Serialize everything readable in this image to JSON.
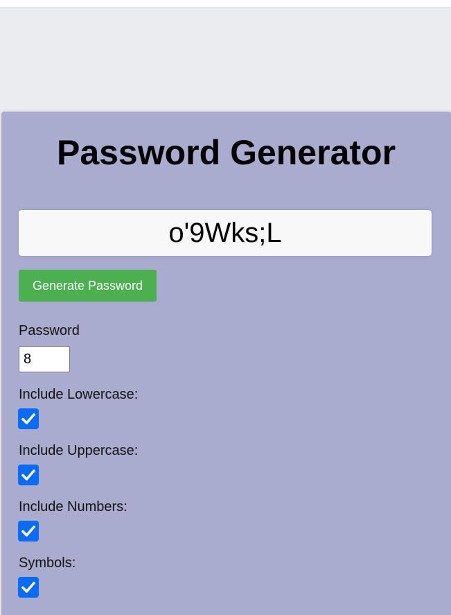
{
  "page": {
    "title": "Password Generator"
  },
  "output": {
    "password": "o'9Wks;L"
  },
  "generate_button": {
    "label": "Generate Password",
    "color": "#4caf50"
  },
  "length_field": {
    "label": "Password",
    "value": "8"
  },
  "options": [
    {
      "label": "Include Lowercase:",
      "checked": true
    },
    {
      "label": "Include Uppercase:",
      "checked": true
    },
    {
      "label": "Include Numbers:",
      "checked": true
    },
    {
      "label": "Symbols:",
      "checked": true
    }
  ],
  "colors": {
    "card_background": "#a9acce",
    "page_background": "#ebecf0",
    "checkbox_accent": "#0a6cf5"
  },
  "icons": {
    "checkbox": "checkmark-icon"
  }
}
